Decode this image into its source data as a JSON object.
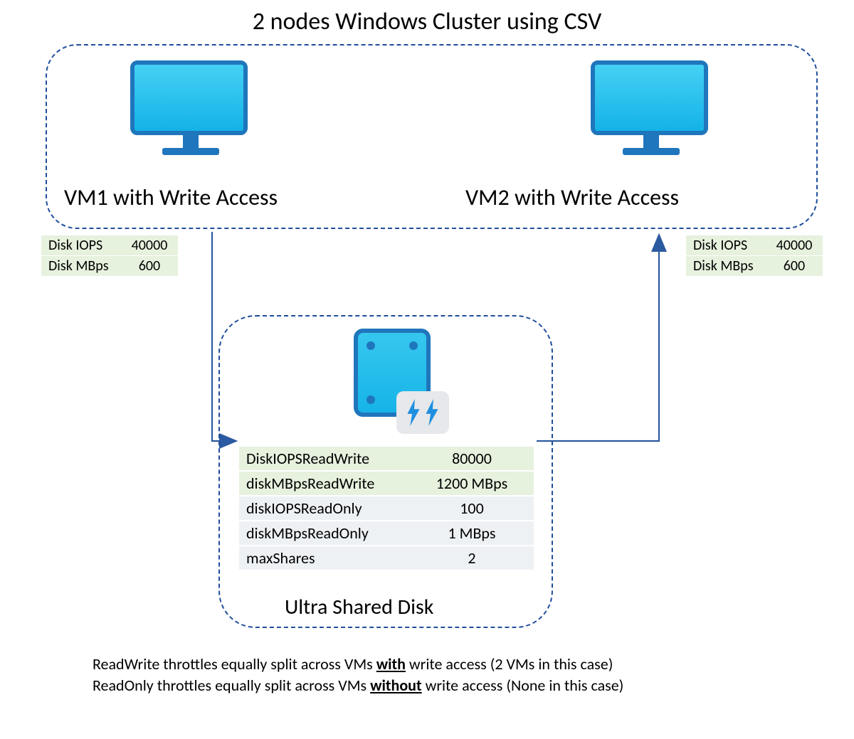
{
  "title": "2 nodes Windows Cluster using CSV",
  "vm1": {
    "label": "VM1 with Write Access",
    "metrics": {
      "iops_label": "Disk IOPS",
      "iops_value": "40000",
      "mbps_label": "Disk MBps",
      "mbps_value": "600"
    }
  },
  "vm2": {
    "label": "VM2 with Write Access",
    "metrics": {
      "iops_label": "Disk IOPS",
      "iops_value": "40000",
      "mbps_label": "Disk MBps",
      "mbps_value": "600"
    }
  },
  "disk": {
    "title": "Ultra Shared Disk",
    "rows": {
      "r0_label": "DiskIOPSReadWrite",
      "r0_value": "80000",
      "r1_label": "diskMBpsReadWrite",
      "r1_value": "1200 MBps",
      "r2_label": "diskIOPSReadOnly",
      "r2_value": "100",
      "r3_label": "diskMBpsReadOnly",
      "r3_value": "1 MBps",
      "r4_label": "maxShares",
      "r4_value": "2"
    }
  },
  "footnotes": {
    "line1_pre": "ReadWrite throttles equally split across VMs ",
    "line1_u": "with",
    "line1_post": " write access (2 VMs in this case)",
    "line2_pre": "ReadOnly throttles equally split across VMs ",
    "line2_u": "without",
    "line2_post": " write access (None in this case)"
  }
}
